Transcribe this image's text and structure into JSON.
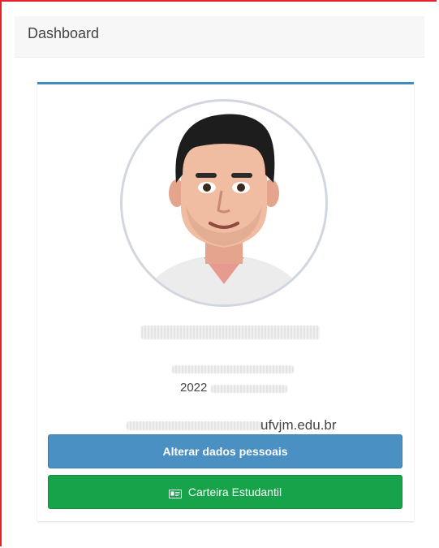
{
  "header": {
    "title": "Dashboard"
  },
  "profile": {
    "year_visible": "2022",
    "email_domain_visible": "ufvjm.edu.br"
  },
  "buttons": {
    "edit_label": "Alterar dados pessoais",
    "card_label": "Carteira Estudantil"
  },
  "colors": {
    "frame_border": "#e8202a",
    "card_accent": "#3c8dbc",
    "edit_button": "#4a90c2",
    "card_button": "#16a34a"
  },
  "icons": {
    "card_button_icon": "id-card-icon"
  }
}
